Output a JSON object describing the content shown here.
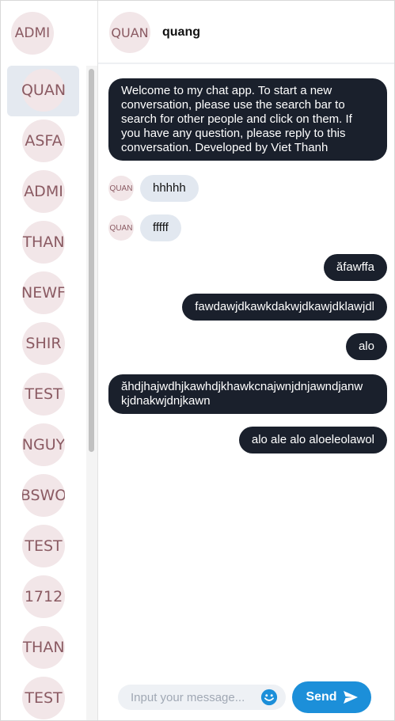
{
  "sidebar": {
    "current_user": "ADMI",
    "contacts": [
      {
        "label": "QUAN",
        "active": true
      },
      {
        "label": "ASFA"
      },
      {
        "label": "ADMI"
      },
      {
        "label": "THAN"
      },
      {
        "label": "NEWF"
      },
      {
        "label": "SHIR"
      },
      {
        "label": "TEST"
      },
      {
        "label": "NGUY"
      },
      {
        "label": "BSWO"
      },
      {
        "label": "TEST"
      },
      {
        "label": "1712"
      },
      {
        "label": "THAN"
      },
      {
        "label": "TEST"
      }
    ]
  },
  "chat": {
    "header_avatar": "QUAN",
    "title": "quang",
    "messages": [
      {
        "direction": "out",
        "text": "Welcome to my chat app. To start a new\nconversation, please use the search bar to\nsearch for other people and click on them. If\nyou have any question, please reply to this\nconversation. Developed by Viet Thanh"
      },
      {
        "direction": "in",
        "avatar": "QUAN",
        "text": "hhhhh"
      },
      {
        "direction": "in",
        "avatar": "QUAN",
        "text": "fffff"
      },
      {
        "direction": "out",
        "text": "ăfawffa"
      },
      {
        "direction": "out",
        "text": "fawdawjdkawkdakwjdkawjdklawjdl"
      },
      {
        "direction": "out",
        "text": "alo"
      },
      {
        "direction": "out",
        "text": "ăhdjhajwdhjkawhdjkhawkcnajwnjdnjawndjanw\nkjdnakwjdnjkawn"
      },
      {
        "direction": "out",
        "text": "alo ale alo aloeleolawol"
      }
    ]
  },
  "composer": {
    "placeholder": "Input your message...",
    "send_label": "Send",
    "emoji_icon": "smiley-icon",
    "send_icon": "paper-plane-icon"
  },
  "colors": {
    "outgoing_bubble": "#1a202c",
    "incoming_bubble": "#e2e8f0",
    "send_button": "#1c8fd9",
    "avatar_bg": "#f2e6e8",
    "avatar_text": "#8a5a62"
  }
}
